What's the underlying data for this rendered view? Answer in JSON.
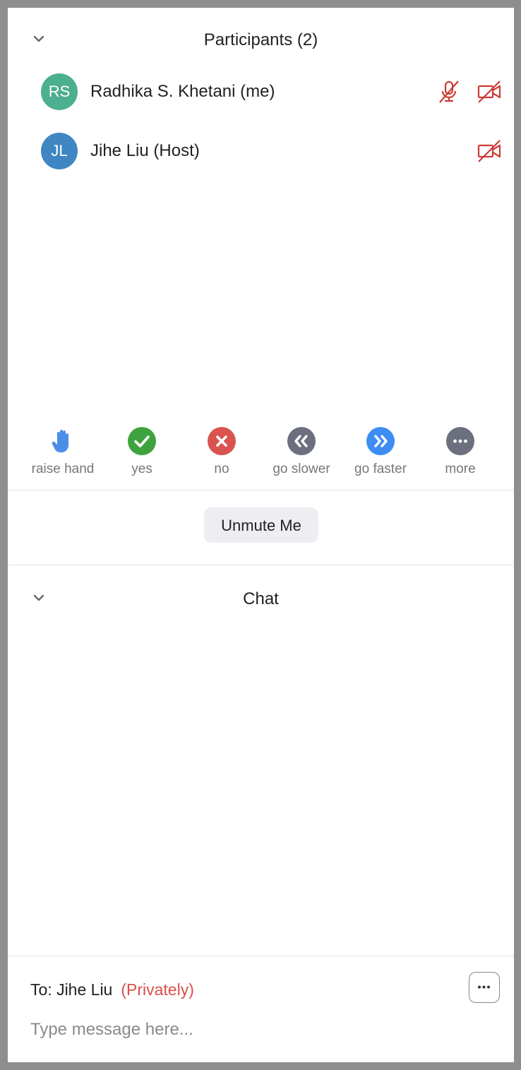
{
  "participants_panel": {
    "title": "Participants (2)",
    "collapse_icon": "chevron-down-icon",
    "list": [
      {
        "initials": "RS",
        "name": "Radhika S. Khetani (me)",
        "avatar_color": "#4caf8f",
        "audio": "muted-mic-icon",
        "video": "video-off-icon"
      },
      {
        "initials": "JL",
        "name": "Jihe Liu (Host)",
        "avatar_color": "#3f86c2",
        "video": "video-off-icon"
      }
    ]
  },
  "reactions": [
    {
      "label": "raise hand",
      "icon": "raised-hand-icon",
      "color": "#4a8ee8"
    },
    {
      "label": "yes",
      "icon": "checkmark-icon",
      "color": "#3ea33e"
    },
    {
      "label": "no",
      "icon": "x-icon",
      "color": "#d9534f"
    },
    {
      "label": "go slower",
      "icon": "rewind-icon",
      "color": "#6b6f7e"
    },
    {
      "label": "go faster",
      "icon": "fast-forward-icon",
      "color": "#3d8df5"
    },
    {
      "label": "more",
      "icon": "more-dots-icon",
      "color": "#6b6f7e"
    }
  ],
  "unmute_button": {
    "label": "Unmute Me"
  },
  "chat_panel": {
    "title": "Chat",
    "collapse_icon": "chevron-down-icon",
    "recipient_prefix": "To: Jihe Liu",
    "recipient_mode": "(Privately)",
    "input_placeholder": "Type message here...",
    "input_value": ""
  },
  "status_color": "#cc3b35"
}
